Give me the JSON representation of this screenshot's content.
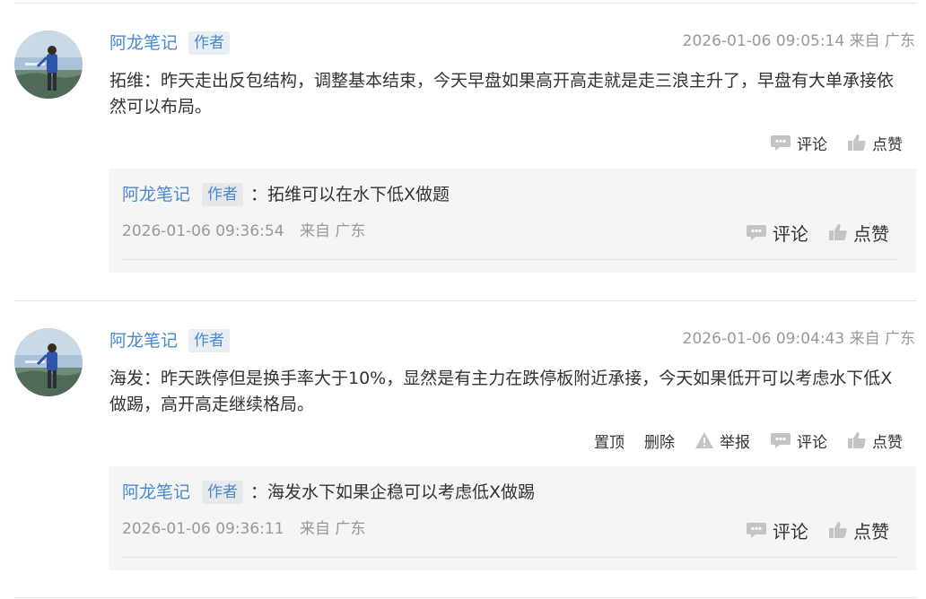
{
  "colors": {
    "link": "#4a88d0",
    "muted": "#999999",
    "text": "#333333",
    "reply_bg": "#f5f5f5"
  },
  "comments": [
    {
      "author": "阿龙笔记",
      "badge": "作者",
      "meta": "2026-01-06 09:05:14 来自 广东",
      "text": "拓维：昨天走出反包结构，调整基本结束，今天早盘如果高开高走就是走三浪主升了，早盘有大单承接依然可以布局。",
      "actions": {
        "comment": "评论",
        "like": "点赞"
      },
      "reply": {
        "author": "阿龙笔记",
        "badge": "作者",
        "text": "：拓维可以在水下低X做题",
        "time": "2026-01-06 09:36:54",
        "location": "来自 广东",
        "actions": {
          "comment": "评论",
          "like": "点赞"
        }
      }
    },
    {
      "author": "阿龙笔记",
      "badge": "作者",
      "meta": "2026-01-06 09:04:43 来自 广东",
      "text": "海发：昨天跌停但是换手率大于10%，显然是有主力在跌停板附近承接，今天如果低开可以考虑水下低X做踢，高开高走继续格局。",
      "actions": {
        "pin": "置顶",
        "delete": "删除",
        "report": "举报",
        "comment": "评论",
        "like": "点赞"
      },
      "reply": {
        "author": "阿龙笔记",
        "badge": "作者",
        "text": "：海发水下如果企稳可以考虑低X做踢",
        "time": "2026-01-06 09:36:11",
        "location": "来自 广东",
        "actions": {
          "comment": "评论",
          "like": "点赞"
        }
      }
    }
  ]
}
